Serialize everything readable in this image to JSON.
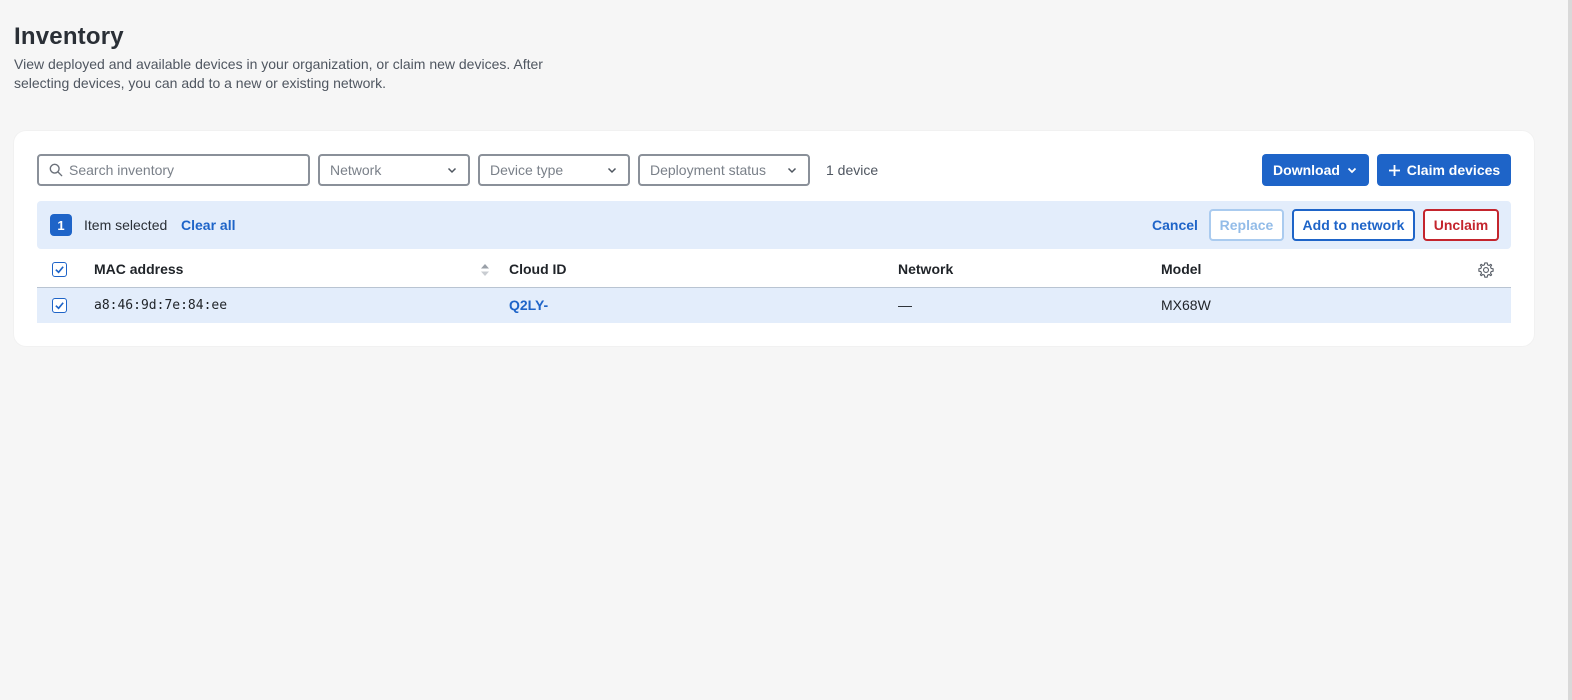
{
  "header": {
    "title": "Inventory",
    "description": "View deployed and available devices in your organization, or claim new devices. After selecting devices, you can add to a new or existing network."
  },
  "toolbar": {
    "search_placeholder": "Search inventory",
    "network_select": "Network",
    "device_type_select": "Device type",
    "deployment_status_select": "Deployment status",
    "device_count": "1 device",
    "download_label": "Download",
    "claim_label": "Claim devices"
  },
  "selection": {
    "count": "1",
    "label": "Item selected",
    "clear_all": "Clear all",
    "cancel": "Cancel",
    "replace": "Replace",
    "add_to_network": "Add to network",
    "unclaim": "Unclaim"
  },
  "table": {
    "columns": [
      "MAC address",
      "Cloud ID",
      "Network",
      "Model"
    ],
    "rows": [
      {
        "mac": "a8:46:9d:7e:84:ee",
        "cloud_id": "Q2LY-",
        "network": "—",
        "model": "MX68W",
        "selected": true
      }
    ]
  },
  "colors": {
    "primary": "#1e64c8",
    "danger": "#c4252d",
    "selection_bg": "#e3edfb"
  }
}
